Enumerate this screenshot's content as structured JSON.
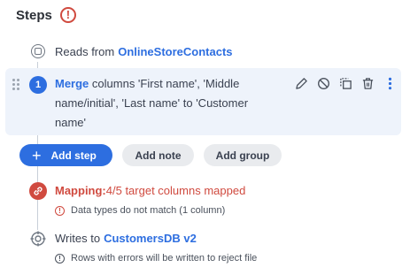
{
  "header": {
    "title": "Steps",
    "warning_glyph": "!"
  },
  "steps": {
    "source": {
      "prefix": "Reads from",
      "name": "OnlineStoreContacts"
    },
    "merge": {
      "number": "1",
      "keyword": "Merge",
      "line1": " columns 'First name', 'Middle",
      "line2": "name/initial', 'Last name' to 'Customer",
      "line3": "name'"
    },
    "mapping": {
      "label": "Mapping:",
      "detail": " 4/5 target columns mapped",
      "note": "Data types do not match (1 column)"
    },
    "target": {
      "prefix": "Writes to",
      "name": "CustomersDB v2",
      "note": "Rows with errors will be written to reject file"
    }
  },
  "buttons": {
    "add_step": "Add step",
    "add_note": "Add note",
    "add_group": "Add group"
  },
  "colors": {
    "accent": "#2d6ee0",
    "error": "#d04a3f",
    "card_bg": "#eef3fb"
  },
  "icons": [
    "warning-icon",
    "source-icon",
    "drag-handle-icon",
    "edit-icon",
    "disable-icon",
    "duplicate-icon",
    "delete-icon",
    "more-icon",
    "plus-icon",
    "link-icon",
    "info-icon",
    "target-icon"
  ]
}
